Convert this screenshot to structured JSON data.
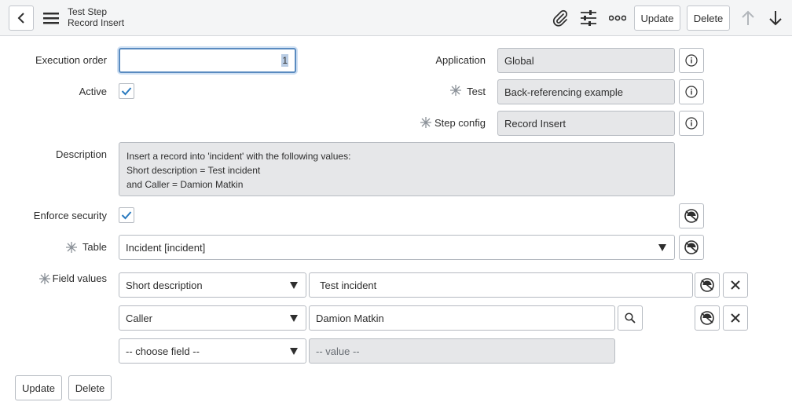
{
  "header": {
    "title_line1": "Test Step",
    "title_line2": "Record Insert",
    "update_label": "Update",
    "delete_label": "Delete"
  },
  "form": {
    "execution_order": {
      "label": "Execution order",
      "value": "1"
    },
    "active": {
      "label": "Active",
      "checked": true
    },
    "application": {
      "label": "Application",
      "value": "Global"
    },
    "test": {
      "label": "Test",
      "value": "Back-referencing example"
    },
    "step_config": {
      "label": "Step config",
      "value": "Record Insert"
    },
    "description": {
      "label": "Description",
      "lines": [
        "Insert a record into 'incident' with the following values:",
        "Short description = Test incident",
        "and Caller = Damion Matkin"
      ]
    },
    "enforce_security": {
      "label": "Enforce security",
      "checked": true
    },
    "table": {
      "label": "Table",
      "value": "Incident [incident]"
    },
    "field_values": {
      "label": "Field values",
      "rows": [
        {
          "field": "Short description",
          "value": "Test incident"
        },
        {
          "field": "Caller",
          "value": "Damion Matkin"
        },
        {
          "field": "-- choose field --",
          "value": "-- value --"
        }
      ]
    }
  },
  "footer": {
    "update_label": "Update",
    "delete_label": "Delete"
  },
  "colors": {
    "header_bg": "#f4f5f6",
    "readonly_bg": "#e6e7e9",
    "checkbox_check": "#2a7abf",
    "focus_border": "#5a8bc0"
  }
}
